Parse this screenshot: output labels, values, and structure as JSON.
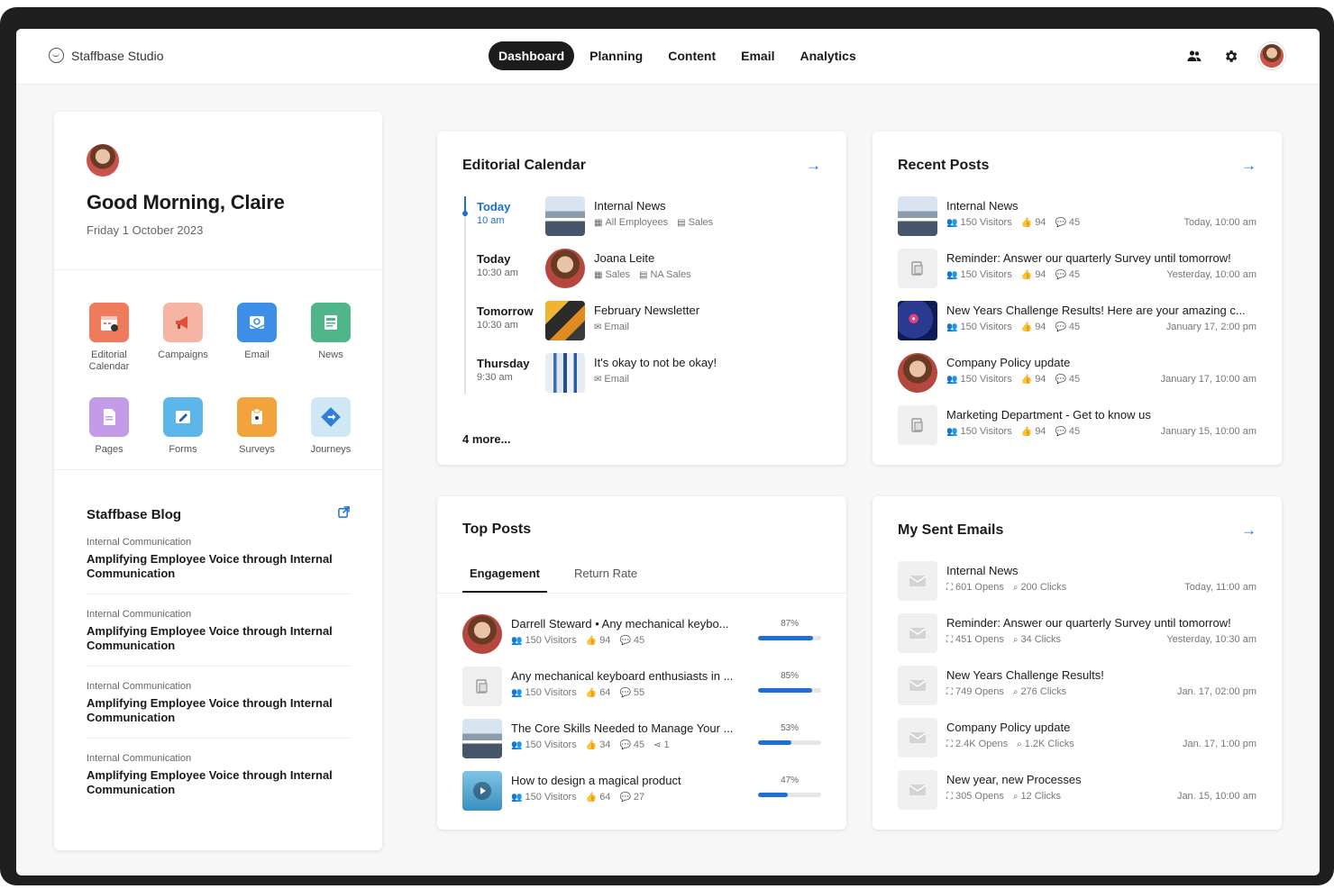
{
  "brand": "Staffbase Studio",
  "nav": [
    "Dashboard",
    "Planning",
    "Content",
    "Email",
    "Analytics"
  ],
  "greeting": {
    "title": "Good Morning, Claire",
    "date": "Friday 1 October 2023"
  },
  "apps": [
    {
      "label": "Editorial Calendar",
      "icon": "calendar-icon",
      "color": "#f07a5c"
    },
    {
      "label": "Campaigns",
      "icon": "megaphone-icon",
      "color": "#f6b5a4"
    },
    {
      "label": "Email",
      "icon": "email-icon",
      "color": "#3c8ee6"
    },
    {
      "label": "News",
      "icon": "news-icon",
      "color": "#4fb58a"
    },
    {
      "label": "Pages",
      "icon": "pages-icon",
      "color": "#c39be8"
    },
    {
      "label": "Forms",
      "icon": "forms-icon",
      "color": "#5cb6ea"
    },
    {
      "label": "Surveys",
      "icon": "survey-icon",
      "color": "#f2a33b"
    },
    {
      "label": "Journeys",
      "icon": "journeys-icon",
      "color": "#9bd0ec"
    }
  ],
  "blog": {
    "title": "Staffbase Blog",
    "items": [
      {
        "category": "Internal Communication",
        "title": "Amplifying Employee Voice through Internal Communication"
      },
      {
        "category": "Internal Communication",
        "title": "Amplifying Employee Voice through Internal Communication"
      },
      {
        "category": "Internal Communication",
        "title": "Amplifying Employee Voice through Internal Communication"
      },
      {
        "category": "Internal Communication",
        "title": "Amplifying Employee Voice through Internal Communication"
      }
    ]
  },
  "editorial": {
    "title": "Editorial Calendar",
    "items": [
      {
        "day": "Today",
        "time": "10 am",
        "title": "Internal News",
        "meta1": "All Employees",
        "meta2": "Sales",
        "thumb": "mountain"
      },
      {
        "day": "Today",
        "time": "10:30 am",
        "title": "Joana Leite",
        "meta1": "Sales",
        "meta2": "NA Sales",
        "thumb": "person"
      },
      {
        "day": "Tomorrow",
        "time": "10:30 am",
        "title": "February Newsletter",
        "meta1": "Email",
        "meta2": "",
        "thumb": "news"
      },
      {
        "day": "Thursday",
        "time": "9:30 am",
        "title": "It's okay to not be okay!",
        "meta1": "Email",
        "meta2": "",
        "thumb": "city"
      }
    ],
    "more": "4 more..."
  },
  "recent": {
    "title": "Recent Posts",
    "items": [
      {
        "title": "Internal News",
        "visitors": "150 Visitors",
        "likes": "94",
        "comments": "45",
        "time": "Today, 10:00 am",
        "thumb": "mountain"
      },
      {
        "title": "Reminder: Answer our quarterly Survey until tomorrow!",
        "visitors": "150 Visitors",
        "likes": "94",
        "comments": "45",
        "time": "Yesterday, 10:00 am",
        "thumb": "doc"
      },
      {
        "title": "New Years Challenge Results! Here are your amazing c...",
        "visitors": "150 Visitors",
        "likes": "94",
        "comments": "45",
        "time": "January 17, 2:00 pm",
        "thumb": "fireworks"
      },
      {
        "title": "Company Policy update",
        "visitors": "150 Visitors",
        "likes": "94",
        "comments": "45",
        "time": "January 17, 10:00 am",
        "thumb": "person"
      },
      {
        "title": "Marketing Department - Get to know us",
        "visitors": "150 Visitors",
        "likes": "94",
        "comments": "45",
        "time": "January 15, 10:00 am",
        "thumb": "doc"
      }
    ]
  },
  "topposts": {
    "title": "Top Posts",
    "tabs": [
      "Engagement",
      "Return Rate"
    ],
    "items": [
      {
        "title": "Darrell Steward • Any mechanical keybo...",
        "visitors": "150 Visitors",
        "likes": "94",
        "comments": "45",
        "shares": "",
        "pct": "87%",
        "value": 87,
        "thumb": "person"
      },
      {
        "title": "Any mechanical keyboard enthusiasts in ...",
        "visitors": "150 Visitors",
        "likes": "64",
        "comments": "55",
        "shares": "",
        "pct": "85%",
        "value": 85,
        "thumb": "doc"
      },
      {
        "title": "The Core Skills Needed to Manage Your ...",
        "visitors": "150 Visitors",
        "likes": "34",
        "comments": "45",
        "shares": "1",
        "pct": "53%",
        "value": 53,
        "thumb": "mountain"
      },
      {
        "title": "How to design a magical product",
        "visitors": "150 Visitors",
        "likes": "64",
        "comments": "27",
        "shares": "",
        "pct": "47%",
        "value": 47,
        "thumb": "video"
      }
    ]
  },
  "emails": {
    "title": "My Sent Emails",
    "items": [
      {
        "title": "Internal News",
        "opens": "601 Opens",
        "clicks": "200 Clicks",
        "time": "Today, 11:00 am"
      },
      {
        "title": "Reminder: Answer our quarterly Survey until tomorrow!",
        "opens": "451 Opens",
        "clicks": "34 Clicks",
        "time": "Yesterday, 10:30 am"
      },
      {
        "title": "New Years Challenge Results!",
        "opens": "749 Opens",
        "clicks": "276 Clicks",
        "time": "Jan. 17, 02:00 pm"
      },
      {
        "title": "Company Policy update",
        "opens": "2.4K Opens",
        "clicks": "1.2K Clicks",
        "time": "Jan. 17, 1:00 pm"
      },
      {
        "title": "New year, new Processes",
        "opens": "305 Opens",
        "clicks": "12 Clicks",
        "time": "Jan. 15, 10:00 am"
      }
    ]
  },
  "colors": {
    "accent": "#1d6fd6",
    "dark": "#1c1c1c"
  }
}
